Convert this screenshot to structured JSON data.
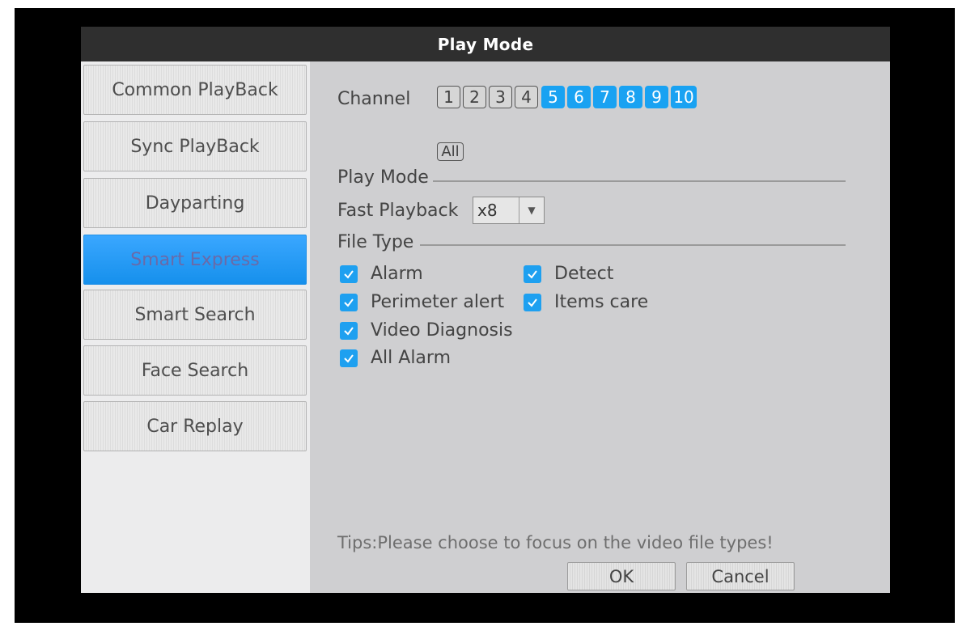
{
  "title": "Play Mode",
  "sidebar": {
    "items": [
      {
        "label": "Common PlayBack",
        "active": false
      },
      {
        "label": "Sync PlayBack",
        "active": false
      },
      {
        "label": "Dayparting",
        "active": false
      },
      {
        "label": "Smart Express",
        "active": true
      },
      {
        "label": "Smart Search",
        "active": false
      },
      {
        "label": "Face Search",
        "active": false
      },
      {
        "label": "Car Replay",
        "active": false
      }
    ]
  },
  "channel": {
    "label": "Channel",
    "numbers": [
      "1",
      "2",
      "3",
      "4",
      "5",
      "6",
      "7",
      "8",
      "9",
      "10"
    ],
    "selected": [
      "5",
      "6",
      "7",
      "8",
      "9",
      "10"
    ],
    "all_label": "All"
  },
  "play_mode": {
    "label": "Play Mode"
  },
  "fast_playback": {
    "label": "Fast Playback",
    "value": "x8"
  },
  "file_type": {
    "label": "File Type",
    "options": [
      {
        "label": "Alarm",
        "checked": true
      },
      {
        "label": "Detect",
        "checked": true
      },
      {
        "label": "Perimeter alert",
        "checked": true
      },
      {
        "label": "Items care",
        "checked": true
      },
      {
        "label": "Video Diagnosis",
        "checked": true
      },
      {
        "label": "All Alarm",
        "checked": true
      }
    ]
  },
  "tips": "Tips:Please choose to focus on the video file types!",
  "buttons": {
    "ok": "OK",
    "cancel": "Cancel"
  },
  "colors": {
    "accent": "#19a2f2",
    "titlebar": "#2f2f2f",
    "panel": "#cfcfd1"
  }
}
